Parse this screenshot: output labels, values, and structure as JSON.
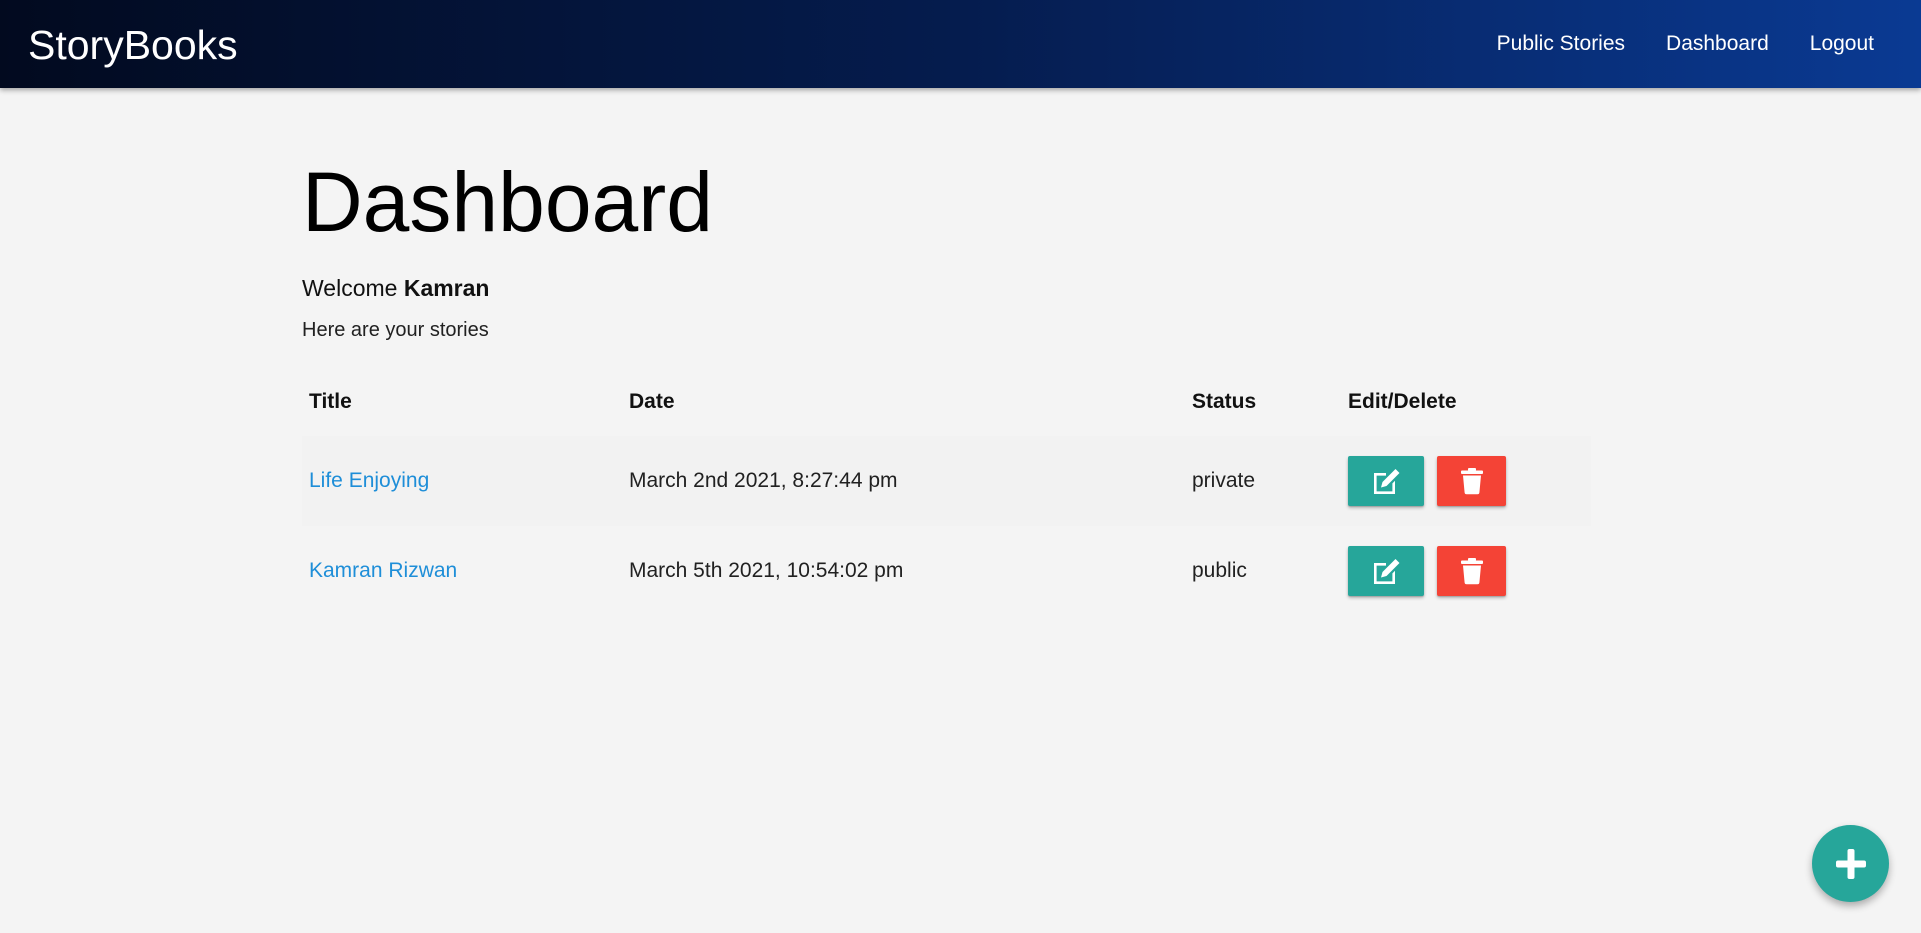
{
  "header": {
    "brand": "StoryBooks",
    "nav": [
      {
        "label": "Public Stories"
      },
      {
        "label": "Dashboard"
      },
      {
        "label": "Logout"
      }
    ],
    "gradient_colors": [
      "#020a1f",
      "#0a3a93"
    ]
  },
  "main": {
    "title": "Dashboard",
    "welcome_prefix": "Welcome ",
    "user_name": "Kamran",
    "subtitle": "Here are your stories",
    "table": {
      "headers": [
        "Title",
        "Date",
        "Status",
        "Edit/Delete"
      ],
      "rows": [
        {
          "title": "Life Enjoying",
          "date": "March 2nd 2021, 8:27:44 pm",
          "status": "private"
        },
        {
          "title": "Kamran Rizwan",
          "date": "March 5th 2021, 10:54:02 pm",
          "status": "public"
        }
      ],
      "edit_icon": "edit-icon",
      "delete_icon": "trash-icon"
    }
  },
  "fab": {
    "icon": "plus-icon"
  },
  "colors": {
    "accent": "#26a69a",
    "danger": "#f44336",
    "link": "#1e8ed8",
    "background": "#f4f4f4"
  }
}
